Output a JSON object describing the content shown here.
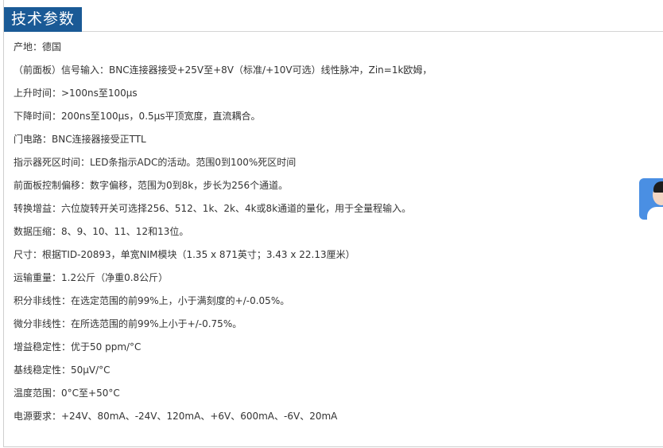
{
  "section": {
    "title": "技术参数"
  },
  "specs": [
    "产地：德国",
    "（前面板）信号输入：BNC连接器接受+25V至+8V（标准/+10V可选）线性脉冲，Zin=1k欧姆，",
    "上升时间：>100ns至100μs",
    "下降时间：200ns至100μs，0.5μs平顶宽度，直流耦合。",
    "门电路：BNC连接器接受正TTL",
    "指示器死区时间：LED条指示ADC的活动。范围0到100%死区时间",
    "前面板控制偏移：数字偏移，范围为0到8k，步长为256个通道。",
    "转换增益：六位旋转开关可选择256、512、1k、2k、4k或8k通道的量化，用于全量程输入。",
    "数据压缩：8、9、10、11、12和13位。",
    "尺寸：根据TID-20893，单宽NIM模块（1.35 x 871英寸；3.43 x 22.13厘米）",
    "运输重量：1.2公斤（净重0.8公斤）",
    "积分非线性：在选定范围的前99%上，小于满刻度的+/-0.05%。",
    "微分非线性：在所选范围的前99%上小于+/-0.75%。",
    "增益稳定性：优于50 ppm/°C",
    "基线稳定性：50μV/°C",
    "温度范围：0°C至+50°C",
    "电源要求：+24V、80mA、-24V、120mA、+6V、600mA、-6V、20mA"
  ],
  "widget": {
    "icon": "customer-service-avatar-icon"
  },
  "colors": {
    "title_bg": "#1a5a96",
    "title_text": "#ffffff",
    "body_text": "#333333",
    "widget_bg": "#4a8fe3"
  }
}
